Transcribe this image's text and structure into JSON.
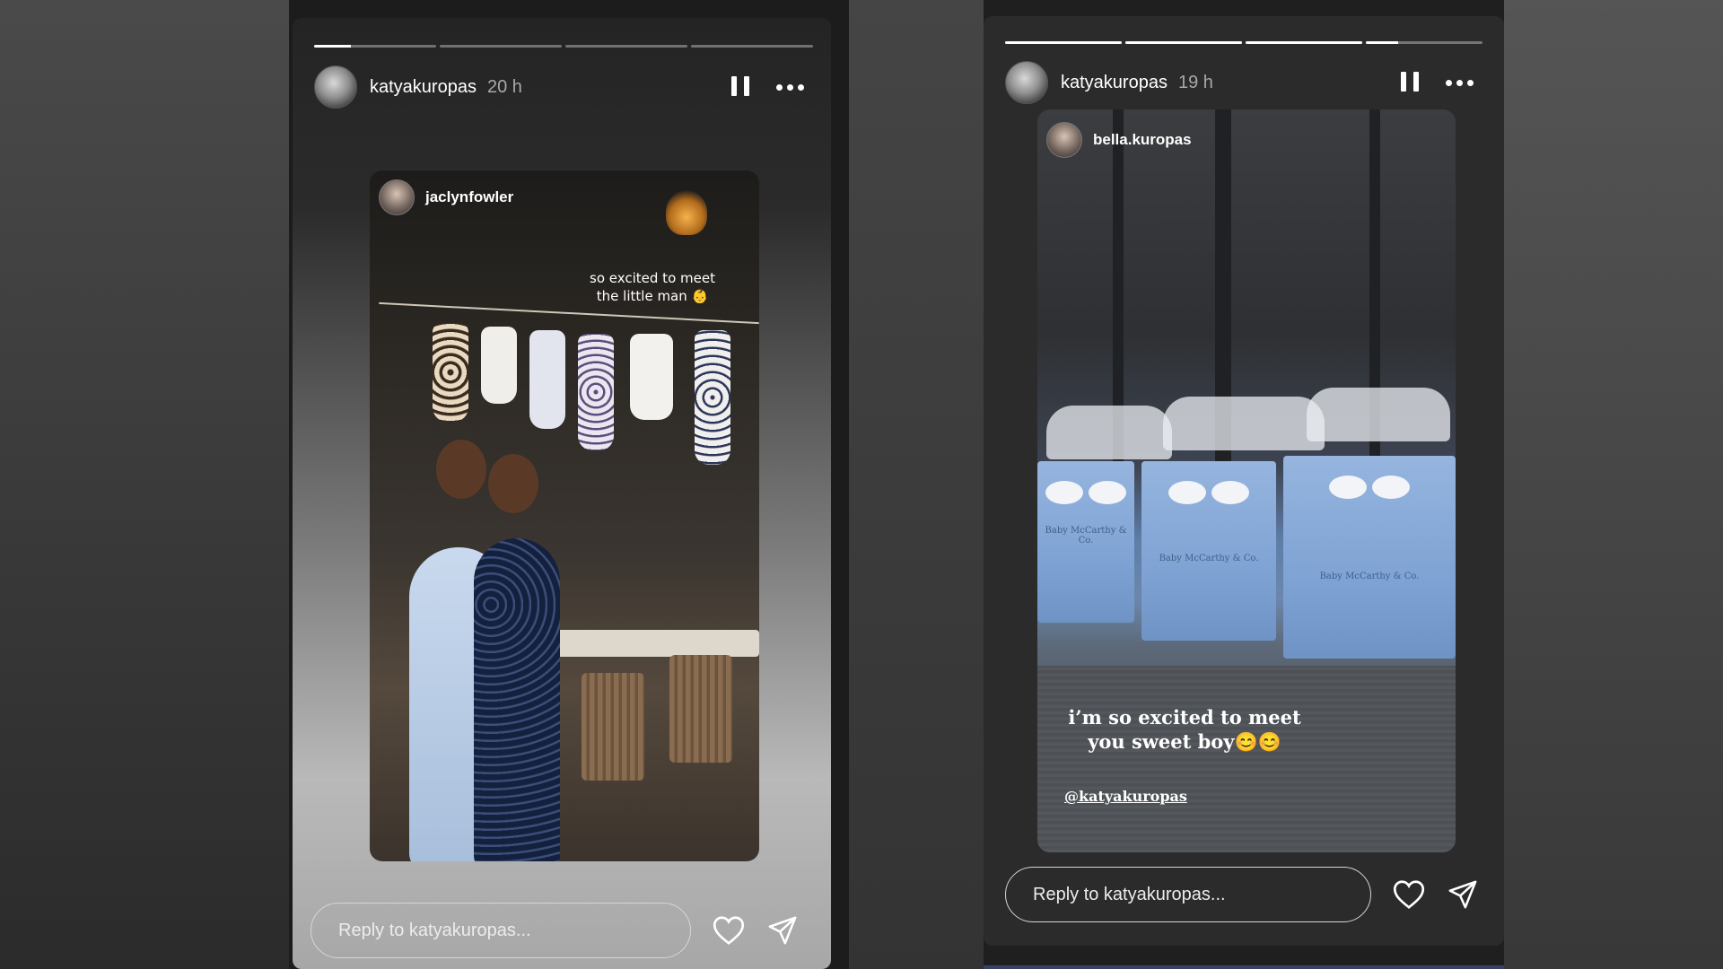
{
  "stories": [
    {
      "username": "katyakuropas",
      "time": "20 h",
      "progress": [
        0.3,
        0,
        0,
        0
      ],
      "post": {
        "username": "jaclynfowler",
        "caption_line1": "so excited to meet",
        "caption_line2": "the little man 👶"
      },
      "reply_placeholder": "Reply to katyakuropas..."
    },
    {
      "username": "katyakuropas",
      "time": "19 h",
      "progress": [
        1,
        1,
        1,
        0.28
      ],
      "post": {
        "username": "bella.kuropas",
        "caption_line1": "i’m so excited to meet",
        "caption_line2": "you sweet boy😊😊",
        "mention": "@katyakuropas",
        "bag_label": "Baby McCarthy & Co."
      },
      "reply_placeholder": "Reply to katyakuropas..."
    }
  ],
  "icons": {
    "pause": "pause-icon",
    "more": "more-icon",
    "heart": "heart-icon",
    "send": "send-icon"
  },
  "colors": {
    "text": "#ffffff",
    "time": "#a8a8a8",
    "progress_track": "rgba(255,255,255,0.35)",
    "progress_fill": "#ffffff"
  }
}
